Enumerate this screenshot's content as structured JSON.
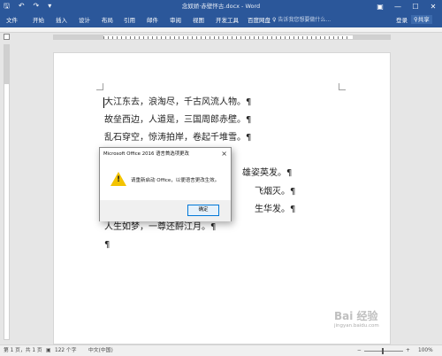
{
  "window": {
    "title": "念奴娇·赤壁怀古.docx - Word",
    "qat": {
      "save_icon": "save-icon",
      "undo_icon": "undo-icon",
      "redo_icon": "redo-icon"
    },
    "controls": {
      "restore": "▣",
      "minimize": "—",
      "maximize": "☐",
      "close": "✕"
    }
  },
  "ribbon": {
    "tabs": [
      "文件",
      "开始",
      "插入",
      "设计",
      "布局",
      "引用",
      "邮件",
      "审阅",
      "视图",
      "开发工具",
      "百度网盘"
    ],
    "tellme": "告诉我您想要做什么...",
    "login": "登录",
    "share": "共享"
  },
  "document": {
    "lines": [
      "大江东去，浪淘尽，千古风流人物。¶",
      "故垒西边，人道是，三国周郎赤壁。¶",
      "乱石穿空，惊涛拍岸，卷起千堆雪。¶",
      "雄姿英发。¶",
      "飞烟灭。¶",
      "生华发。¶",
      "人生如梦，一尊还酹江月。¶",
      "¶"
    ]
  },
  "dialog": {
    "title": "Microsoft Office 2016 语言首选项更改",
    "message": "请重新启动 Office，以便语言更改生效。",
    "ok": "确定",
    "close": "×",
    "icon": "warning-icon"
  },
  "statusbar": {
    "page": "第 1 页，共 1 页",
    "words": "122 个字",
    "language": "中文(中国)",
    "zoom": "100%",
    "zoom_minus": "−",
    "zoom_plus": "+"
  },
  "watermark": {
    "text": "Bai 经验",
    "sub": "jingyan.baidu.com"
  },
  "colors": {
    "accent": "#2b579a",
    "warning": "#f3c300",
    "button_border": "#0078d7"
  }
}
